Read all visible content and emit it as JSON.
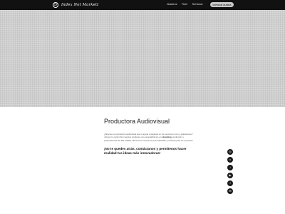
{
  "nav": {
    "logo_mark": "D",
    "logo_text": "Index  Not  Markett",
    "links": [
      "Nosotros",
      "Reel",
      "Servicios"
    ],
    "cta_label": "COTIZAR AHORA"
  },
  "section": {
    "title": "Productora Audiovisual",
    "body_pre": "¿Buscas una productora audiovisual que te ayude a destacar en tus eventos en vivo y grabaciones? ¡Somos tu opción! En nuestros productos nos especializamos en ",
    "body_bold": "streaming",
    "body_post": ", producción y postproducción de alta calidad. Ofrecemos soluciones personalizadas y creativas para tus proyectos.",
    "cta_text": "¡No te quedes atrás, contáctanos y permítenos hacer realidad tus ideas más innovadoras!"
  },
  "social": {
    "items": [
      {
        "icon": "instagram-icon",
        "glyph": "◎"
      },
      {
        "icon": "vimeo-icon",
        "glyph": "v"
      },
      {
        "icon": "tiktok-icon",
        "glyph": "♪"
      },
      {
        "icon": "youtube-icon",
        "glyph": "▶"
      },
      {
        "icon": "facebook-icon",
        "glyph": "f"
      },
      {
        "icon": "email-icon",
        "glyph": "✉"
      }
    ]
  },
  "colors": {
    "navbar": "#111111",
    "hero": "#cfcfcf",
    "button": "#c9c9c9",
    "social": "#1b1b1b"
  }
}
